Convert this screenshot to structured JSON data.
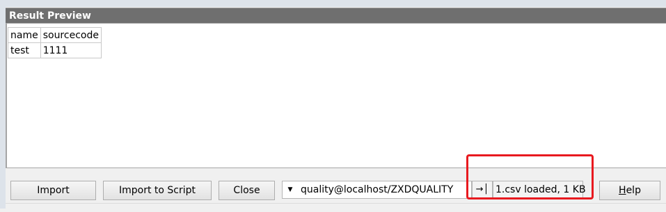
{
  "panel": {
    "title": "Result Preview"
  },
  "table": {
    "columns": [
      "name",
      "sourcecode"
    ],
    "rows": [
      [
        "test",
        "1111"
      ]
    ]
  },
  "buttons": {
    "import": "Import",
    "import_to_script": "Import to Script",
    "close": "Close",
    "help_mnemonic": "H",
    "help_rest": "elp"
  },
  "connection": {
    "selected": "quality@localhost/ZXDQUALITY"
  },
  "status": {
    "text": "1.csv loaded,  1 KB"
  },
  "icons": {
    "connection_dropdown": "chevron-down-icon",
    "pin": "pin-icon"
  },
  "colors": {
    "highlight": "#e8191f",
    "header_bg": "#6f6f6f"
  }
}
